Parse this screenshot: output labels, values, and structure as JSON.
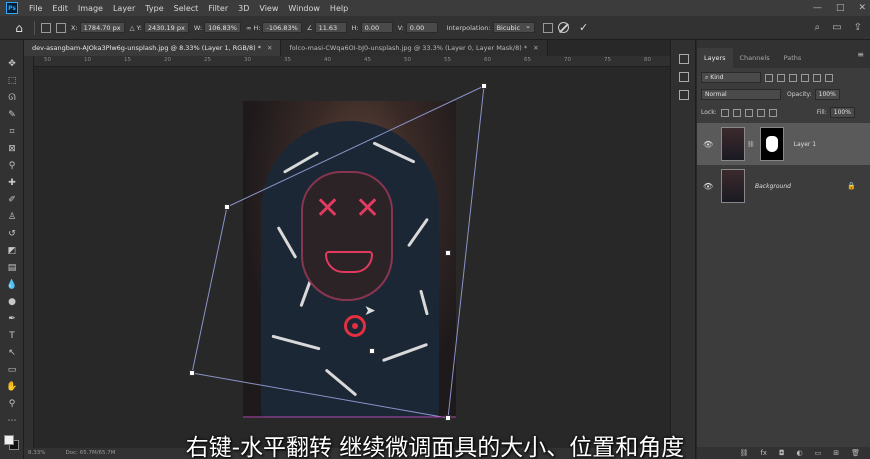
{
  "menubar": {
    "logo": "Ps",
    "items": [
      "File",
      "Edit",
      "Image",
      "Layer",
      "Type",
      "Select",
      "Filter",
      "3D",
      "View",
      "Window",
      "Help"
    ],
    "window_controls": [
      "—",
      "□",
      "✕"
    ]
  },
  "options": {
    "x_label": "X:",
    "x_value": "1784.70 px",
    "y_label": "Y:",
    "y_value": "2430.19 px",
    "w_label": "W:",
    "w_value": "106.83%",
    "h_label": "H:",
    "h_value": "-106.83%",
    "angle_value": "11.63",
    "hskew_label": "H:",
    "hskew_value": "0.00",
    "vskew_label": "V:",
    "vskew_value": "0.00",
    "interp_label": "Interpolation:",
    "interp_value": "Bicubic"
  },
  "tabs": [
    {
      "label": "dev-asangbam-AJOka3Plw6g-unsplash.jpg @ 8.33% (Layer 1, RGB/8) *",
      "close": "✕"
    },
    {
      "label": "folco-masi-CWqa6OI-bJ0-unsplash.jpg @ 33.3% (Layer 0, Layer Mask/8) *",
      "close": "✕"
    }
  ],
  "ruler": {
    "top_labels": [
      "50",
      "10",
      "15",
      "20",
      "25",
      "30",
      "35",
      "40",
      "45",
      "50",
      "55",
      "60",
      "65",
      "70",
      "75",
      "80"
    ]
  },
  "status": {
    "zoom": "8.33%",
    "doc": "Doc: 65.7M/65.7M"
  },
  "layers_panel": {
    "tabs": [
      "Layers",
      "Channels",
      "Paths"
    ],
    "menu_icon": "≡",
    "kind_placeholder": "Kind",
    "blend_mode": "Normal",
    "opacity_label": "Opacity:",
    "opacity_value": "100%",
    "lock_label": "Lock:",
    "fill_label": "Fill:",
    "fill_value": "100%",
    "layers": [
      {
        "name": "Layer 1",
        "visible": true,
        "has_mask": true,
        "selected": true
      },
      {
        "name": "Background",
        "visible": true,
        "has_mask": false,
        "locked": true
      }
    ],
    "footer_icons": [
      "link-icon",
      "fx-icon",
      "mask-icon",
      "adjustment-icon",
      "folder-icon",
      "new-layer-icon",
      "trash-icon"
    ]
  },
  "subtitle": "右键-水平翻转 继续微调面具的大小、位置和角度",
  "colors": {
    "accent": "#31a8ff",
    "mask_glow": "#e23a5f",
    "cursor_ring": "#e23040"
  }
}
